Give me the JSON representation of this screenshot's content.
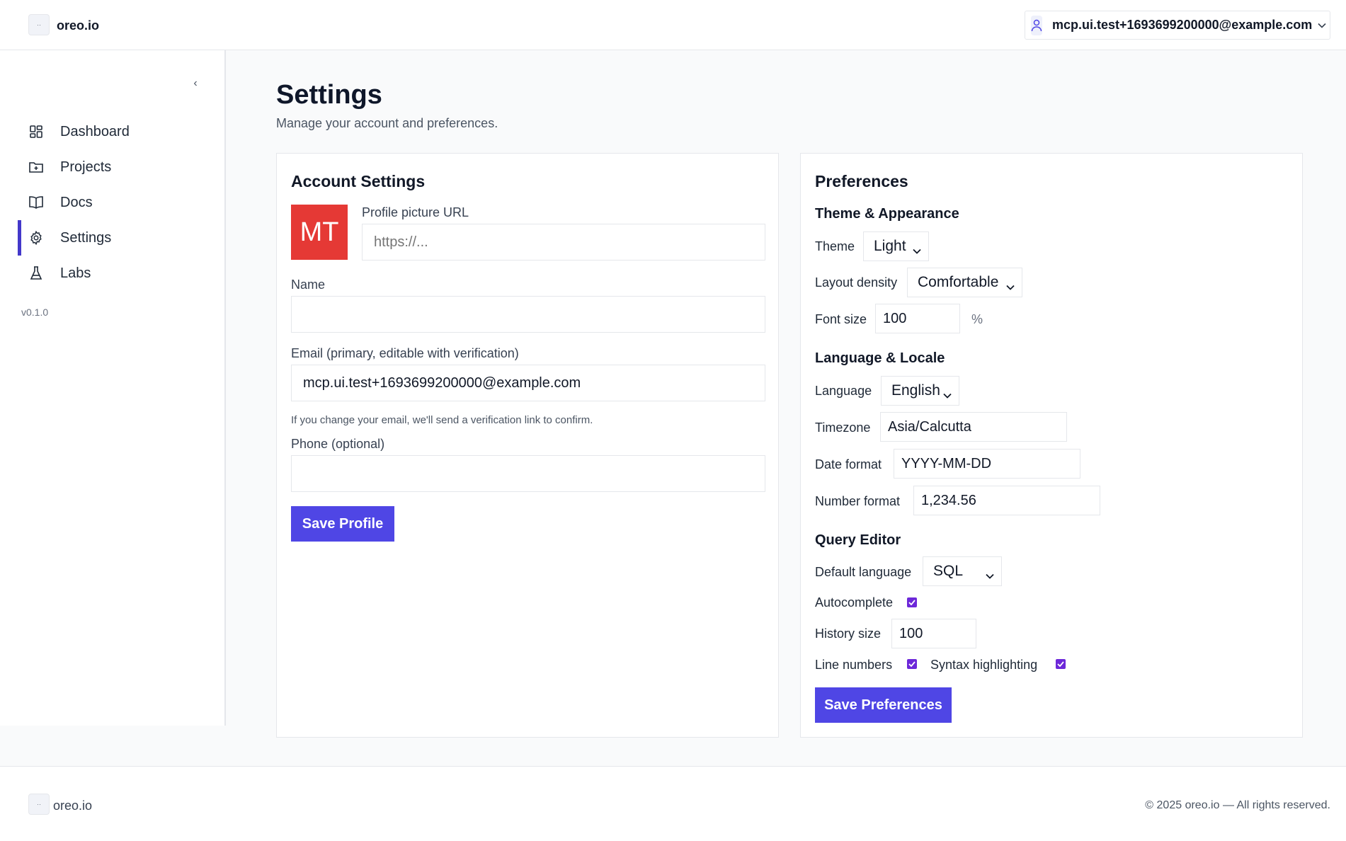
{
  "app": {
    "brand": "oreo.io",
    "user_email": "mcp.ui.test+1693699200000@example.com",
    "logo_glyph": "··"
  },
  "sidebar": {
    "collapse_glyph": "‹",
    "items": [
      {
        "label": "Dashboard",
        "icon": "dashboard-icon"
      },
      {
        "label": "Projects",
        "icon": "folder-plus-icon"
      },
      {
        "label": "Docs",
        "icon": "book-icon"
      },
      {
        "label": "Settings",
        "icon": "gear-icon",
        "active": true
      },
      {
        "label": "Labs",
        "icon": "flask-icon"
      }
    ],
    "version": "v0.1.0"
  },
  "page": {
    "title": "Settings",
    "subtitle": "Manage your account and preferences."
  },
  "account": {
    "title": "Account Settings",
    "avatar_initials": "MT",
    "avatar_color": "#e53935",
    "profile_url_label": "Profile picture URL",
    "profile_url_placeholder": "https://...",
    "name_label": "Name",
    "name_value": "",
    "email_label": "Email (primary, editable with verification)",
    "email_value": "mcp.ui.test+1693699200000@example.com",
    "email_hint": "If you change your email, we'll send a verification link to confirm.",
    "phone_label": "Phone (optional)",
    "phone_value": "",
    "save_label": "Save Profile"
  },
  "preferences": {
    "title": "Preferences",
    "theme_section": "Theme & Appearance",
    "theme_label": "Theme",
    "theme_value": "Light",
    "density_label": "Layout density",
    "density_value": "Comfortable",
    "font_size_label": "Font size",
    "font_size_value": "100",
    "font_size_unit": "%",
    "locale_section": "Language & Locale",
    "language_label": "Language",
    "language_value": "English",
    "timezone_label": "Timezone",
    "timezone_value": "Asia/Calcutta",
    "date_format_label": "Date format",
    "date_format_value": "YYYY-MM-DD",
    "number_format_label": "Number format",
    "number_format_value": "1,234.56",
    "editor_section": "Query Editor",
    "default_language_label": "Default language",
    "default_language_value": "SQL",
    "autocomplete_label": "Autocomplete",
    "autocomplete_checked": true,
    "history_size_label": "History size",
    "history_size_value": "100",
    "line_numbers_label": "Line numbers",
    "line_numbers_checked": true,
    "syntax_label": "Syntax highlighting",
    "syntax_checked": true,
    "save_label": "Save Preferences"
  },
  "footer": {
    "brand": "oreo.io",
    "copyright": "© 2025 oreo.io — All rights reserved."
  },
  "colors": {
    "primary": "#4f46e5",
    "active_indicator": "#4338ca",
    "checkbox": "#6d28d9"
  }
}
